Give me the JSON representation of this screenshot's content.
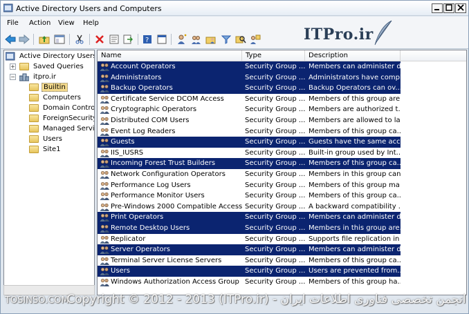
{
  "window": {
    "title": "Active Directory Users and Computers"
  },
  "menu": [
    "File",
    "Action",
    "View",
    "Help"
  ],
  "toolbar_icons": [
    "back-icon",
    "forward-icon",
    "up-folder-icon",
    "show-tree-icon",
    "cut-icon",
    "delete-icon",
    "properties-icon",
    "export-icon",
    "help-icon",
    "console-icon",
    "new-user-icon",
    "new-group-icon",
    "new-ou-icon",
    "filter-icon",
    "find-icon",
    "add-to-group-icon"
  ],
  "logo": {
    "text": "ITPro.ir"
  },
  "tree": {
    "root": "Active Directory Users a",
    "saved_queries": "Saved Queries",
    "domain": "itpro.ir",
    "children": [
      "Builtin",
      "Computers",
      "Domain Controll",
      "ForeignSecurityI",
      "Managed Servic",
      "Users",
      "Site1"
    ]
  },
  "list": {
    "columns": [
      "Name",
      "Type",
      "Description"
    ],
    "rows": [
      {
        "name": "Account Operators",
        "type": "Security Group ...",
        "desc": "Members can administer d...",
        "selected": true
      },
      {
        "name": "Administrators",
        "type": "Security Group ...",
        "desc": "Administrators have compl...",
        "selected": true
      },
      {
        "name": "Backup Operators",
        "type": "Security Group ...",
        "desc": "Backup Operators can ov...",
        "selected": true
      },
      {
        "name": "Certificate Service DCOM Access",
        "type": "Security Group ...",
        "desc": "Members of this group are...",
        "selected": false
      },
      {
        "name": "Cryptographic Operators",
        "type": "Security Group ...",
        "desc": "Members are authorized t...",
        "selected": false
      },
      {
        "name": "Distributed COM Users",
        "type": "Security Group ...",
        "desc": "Members are allowed to la...",
        "selected": false
      },
      {
        "name": "Event Log Readers",
        "type": "Security Group ...",
        "desc": "Members of this group ca...",
        "selected": false
      },
      {
        "name": "Guests",
        "type": "Security Group ...",
        "desc": "Guests have the same acc...",
        "selected": true
      },
      {
        "name": "IIS_IUSRS",
        "type": "Security Group ...",
        "desc": "Built-in group used by Int...",
        "selected": false
      },
      {
        "name": "Incoming Forest Trust Builders",
        "type": "Security Group ...",
        "desc": "Members of this group ca...",
        "selected": true
      },
      {
        "name": "Network Configuration Operators",
        "type": "Security Group ...",
        "desc": "Members in this group can...",
        "selected": false
      },
      {
        "name": "Performance Log Users",
        "type": "Security Group ...",
        "desc": "Members of this group ma...",
        "selected": false
      },
      {
        "name": "Performance Monitor Users",
        "type": "Security Group ...",
        "desc": "Members of this group ca...",
        "selected": false
      },
      {
        "name": "Pre-Windows 2000 Compatible Access",
        "type": "Security Group ...",
        "desc": "A backward compatibility ...",
        "selected": false
      },
      {
        "name": "Print Operators",
        "type": "Security Group ...",
        "desc": "Members can administer d...",
        "selected": true
      },
      {
        "name": "Remote Desktop Users",
        "type": "Security Group ...",
        "desc": "Members in this group are...",
        "selected": true
      },
      {
        "name": "Replicator",
        "type": "Security Group ...",
        "desc": "Supports file replication in ...",
        "selected": false
      },
      {
        "name": "Server Operators",
        "type": "Security Group ...",
        "desc": "Members can administer d...",
        "selected": true
      },
      {
        "name": "Terminal Server License Servers",
        "type": "Security Group ...",
        "desc": "Members of this group ca...",
        "selected": false
      },
      {
        "name": "Users",
        "type": "Security Group ...",
        "desc": "Users are prevented from...",
        "selected": true
      },
      {
        "name": "Windows Authorization Access Group",
        "type": "Security Group ...",
        "desc": "Members of this group ha...",
        "selected": false
      }
    ]
  },
  "watermark": {
    "left": "TOSINSO.COM",
    "center": "Copyright © 2012 - 2013 (ITPro.ir) - انجمن تخصصی فناوری اطلاعات ایران"
  },
  "colors": {
    "selection": "#0b2470",
    "tree_selected": "#f3d98c"
  }
}
